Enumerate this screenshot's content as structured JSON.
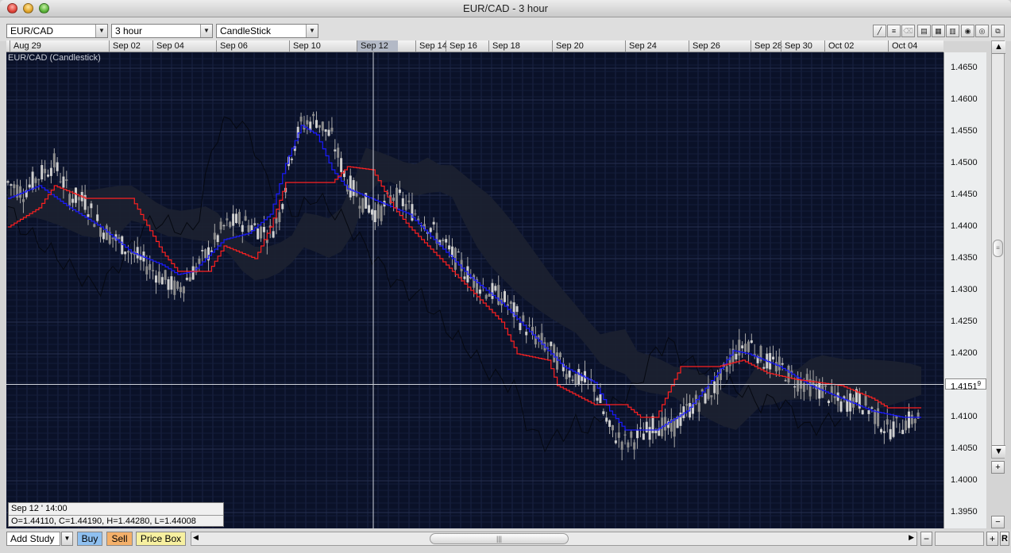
{
  "window": {
    "title": "EUR/CAD - 3 hour"
  },
  "toolbar": {
    "symbol": "EUR/CAD",
    "interval": "3 hour",
    "chart_style": "CandleStick"
  },
  "chart": {
    "title": "EUR/CAD (Candlestick)",
    "date_labels": [
      "Aug 29",
      "Sep 02",
      "Sep 04",
      "Sep 06",
      "Sep 10",
      "Sep 12",
      "Sep 14",
      "Sep 16",
      "Sep 18",
      "Sep 20",
      "Sep 24",
      "Sep 26",
      "Sep 28",
      "Sep 30",
      "Oct 02",
      "Oct 04"
    ],
    "price_labels": [
      "1.4650",
      "1.4600",
      "1.4550",
      "1.4500",
      "1.4450",
      "1.4400",
      "1.4350",
      "1.4300",
      "1.4250",
      "1.4200",
      "1.4100",
      "1.4050",
      "1.4000",
      "1.3950"
    ],
    "current_price_label": "1.4151",
    "current_price_suffix": "9",
    "highlighted_date": "Sep 12"
  },
  "infobox": {
    "time": "Sep 12 ' 14:00",
    "ohlc": "O=1.44110, C=1.44190, H=1.44280, L=1.44008"
  },
  "bottom": {
    "add_study": "Add Study",
    "buy": "Buy",
    "sell": "Sell",
    "price_box": "Price Box",
    "r_label": "R"
  },
  "colors": {
    "background": "#0a1128",
    "candle": "#a8a8a8",
    "tenkan": "#1a1aff",
    "kijun": "#ff2020",
    "cloud": "#1c2130",
    "chikou": "#050810",
    "buy_btn": "#8fc0f0",
    "sell_btn": "#f4b06a",
    "pricebox_btn": "#f7f0a0"
  },
  "chart_data": {
    "type": "candlestick",
    "title": "EUR/CAD (Candlestick)",
    "interval": "3 hour",
    "xlabel": "",
    "ylabel": "",
    "ylim": [
      1.3925,
      1.4675
    ],
    "x_ticks": [
      "Aug 29",
      "Sep 02",
      "Sep 04",
      "Sep 06",
      "Sep 10",
      "Sep 12",
      "Sep 14",
      "Sep 16",
      "Sep 18",
      "Sep 20",
      "Sep 24",
      "Sep 26",
      "Sep 28",
      "Sep 30",
      "Oct 02",
      "Oct 04"
    ],
    "y_ticks": [
      1.465,
      1.46,
      1.455,
      1.45,
      1.445,
      1.44,
      1.435,
      1.43,
      1.425,
      1.42,
      1.41,
      1.405,
      1.4,
      1.395
    ],
    "current_price": 1.41519,
    "close_path": [
      [
        0,
        1.447
      ],
      [
        5,
        1.4455
      ],
      [
        10,
        1.448
      ],
      [
        15,
        1.45
      ],
      [
        20,
        1.445
      ],
      [
        25,
        1.444
      ],
      [
        30,
        1.44
      ],
      [
        35,
        1.438
      ],
      [
        40,
        1.436
      ],
      [
        45,
        1.434
      ],
      [
        50,
        1.432
      ],
      [
        55,
        1.43
      ],
      [
        60,
        1.433
      ],
      [
        65,
        1.436
      ],
      [
        70,
        1.44
      ],
      [
        75,
        1.441
      ],
      [
        80,
        1.44
      ],
      [
        85,
        1.439
      ],
      [
        88,
        1.442
      ],
      [
        92,
        1.452
      ],
      [
        95,
        1.456
      ],
      [
        100,
        1.457
      ],
      [
        105,
        1.454
      ],
      [
        110,
        1.447
      ],
      [
        115,
        1.444
      ],
      [
        120,
        1.442
      ],
      [
        125,
        1.445
      ],
      [
        130,
        1.443
      ],
      [
        135,
        1.441
      ],
      [
        140,
        1.438
      ],
      [
        145,
        1.435
      ],
      [
        150,
        1.432
      ],
      [
        155,
        1.43
      ],
      [
        160,
        1.429
      ],
      [
        165,
        1.426
      ],
      [
        170,
        1.423
      ],
      [
        175,
        1.421
      ],
      [
        180,
        1.418
      ],
      [
        185,
        1.416
      ],
      [
        190,
        1.415
      ],
      [
        195,
        1.408
      ],
      [
        200,
        1.406
      ],
      [
        205,
        1.407
      ],
      [
        210,
        1.409
      ],
      [
        215,
        1.408
      ],
      [
        220,
        1.411
      ],
      [
        225,
        1.413
      ],
      [
        230,
        1.415
      ],
      [
        235,
        1.42
      ],
      [
        240,
        1.422
      ],
      [
        245,
        1.419
      ],
      [
        250,
        1.418
      ],
      [
        255,
        1.416
      ],
      [
        260,
        1.415
      ],
      [
        265,
        1.414
      ],
      [
        270,
        1.412
      ],
      [
        275,
        1.413
      ],
      [
        280,
        1.411
      ],
      [
        285,
        1.408
      ],
      [
        290,
        1.409
      ],
      [
        295,
        1.41
      ]
    ],
    "tenkan_sen": [
      [
        0,
        1.4445
      ],
      [
        10,
        1.4465
      ],
      [
        20,
        1.443
      ],
      [
        30,
        1.44
      ],
      [
        40,
        1.436
      ],
      [
        50,
        1.434
      ],
      [
        55,
        1.4325
      ],
      [
        60,
        1.433
      ],
      [
        70,
        1.438
      ],
      [
        78,
        1.439
      ],
      [
        85,
        1.442
      ],
      [
        90,
        1.45
      ],
      [
        95,
        1.456
      ],
      [
        100,
        1.4545
      ],
      [
        105,
        1.449
      ],
      [
        110,
        1.446
      ],
      [
        120,
        1.444
      ],
      [
        130,
        1.442
      ],
      [
        140,
        1.437
      ],
      [
        150,
        1.432
      ],
      [
        160,
        1.428
      ],
      [
        170,
        1.423
      ],
      [
        180,
        1.418
      ],
      [
        190,
        1.4155
      ],
      [
        195,
        1.411
      ],
      [
        200,
        1.408
      ],
      [
        210,
        1.408
      ],
      [
        220,
        1.411
      ],
      [
        230,
        1.417
      ],
      [
        235,
        1.4205
      ],
      [
        240,
        1.42
      ],
      [
        250,
        1.418
      ],
      [
        260,
        1.415
      ],
      [
        270,
        1.413
      ],
      [
        280,
        1.411
      ],
      [
        290,
        1.41
      ],
      [
        295,
        1.41
      ]
    ],
    "kijun_sen": [
      [
        0,
        1.44
      ],
      [
        10,
        1.443
      ],
      [
        15,
        1.4465
      ],
      [
        25,
        1.4445
      ],
      [
        40,
        1.4445
      ],
      [
        50,
        1.436
      ],
      [
        55,
        1.433
      ],
      [
        65,
        1.433
      ],
      [
        70,
        1.437
      ],
      [
        80,
        1.435
      ],
      [
        85,
        1.44
      ],
      [
        90,
        1.447
      ],
      [
        105,
        1.447
      ],
      [
        110,
        1.4495
      ],
      [
        118,
        1.449
      ],
      [
        125,
        1.443
      ],
      [
        130,
        1.44
      ],
      [
        140,
        1.435
      ],
      [
        150,
        1.43
      ],
      [
        160,
        1.425
      ],
      [
        165,
        1.42
      ],
      [
        175,
        1.419
      ],
      [
        178,
        1.415
      ],
      [
        190,
        1.412
      ],
      [
        200,
        1.412
      ],
      [
        205,
        1.41
      ],
      [
        210,
        1.41
      ],
      [
        218,
        1.418
      ],
      [
        230,
        1.418
      ],
      [
        238,
        1.419
      ],
      [
        246,
        1.417
      ],
      [
        255,
        1.416
      ],
      [
        270,
        1.415
      ],
      [
        280,
        1.413
      ],
      [
        285,
        1.4115
      ],
      [
        295,
        1.4115
      ]
    ]
  }
}
